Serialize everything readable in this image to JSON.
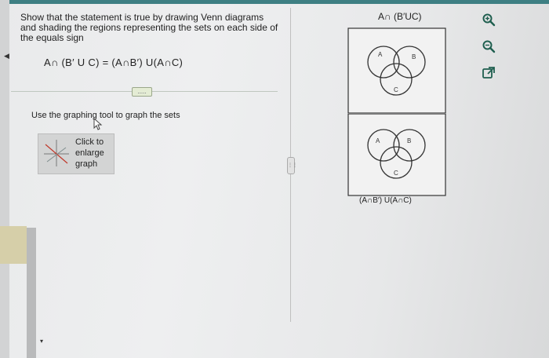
{
  "question": {
    "prompt": "Show that the statement is true by drawing Venn diagrams and shading the regions representing the sets on each side of the equals sign",
    "equation": "A∩ (B′ U C) = (A∩B′) U(A∩C)"
  },
  "toolbar": {
    "more_label": "....."
  },
  "instruction": "Use the graphing tool to graph the sets",
  "graph_button": {
    "label": "Click to enlarge graph"
  },
  "panel_handle": "⋮⋮",
  "venn_top": {
    "title": "A∩ (B′UC)",
    "label_a": "A",
    "label_b": "B",
    "label_c": "C"
  },
  "venn_bottom": {
    "title": "(A∩B′) U(A∩C)",
    "label_a": "A",
    "label_b": "B",
    "label_c": "C"
  },
  "side_tools": [
    "zoom-in-icon",
    "zoom-out-icon",
    "popout-icon"
  ],
  "colors": {
    "accent_bar": "#3e7f83",
    "circle_stroke": "#333333"
  }
}
